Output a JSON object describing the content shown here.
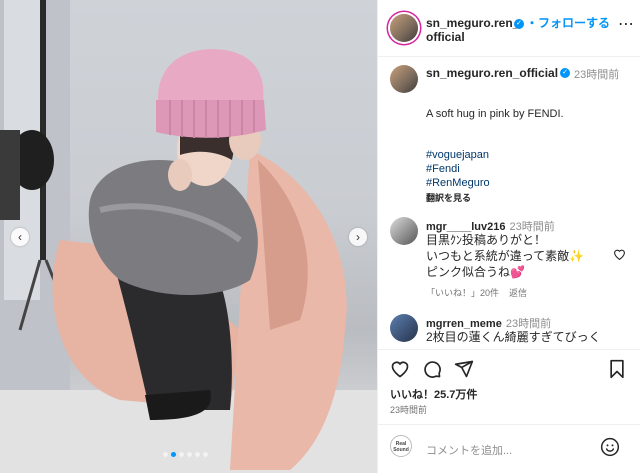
{
  "post": {
    "username": "sn_meguro.ren_official",
    "username_line1": "sn_meguro.ren_",
    "username_line2": "official",
    "follow_label": "・フォローする",
    "more_icon": "more-horizontal-icon",
    "carousel": {
      "total_slides": 6,
      "active_slide": 2
    }
  },
  "caption": {
    "username": "sn_meguro.ren_official",
    "time": "23時間前",
    "text": "A soft hug in pink by FENDI.",
    "hashtags": [
      "#voguejapan",
      "#Fendi",
      "#RenMeguro"
    ],
    "translate_label": "翻訳を見る"
  },
  "comments": [
    {
      "username": "mgr____luv216",
      "time": "23時間前",
      "lines": [
        "目黒ｸﾝ投稿ありがと！",
        "いつもと系統が違って素敵✨",
        "ピンク似合うね💕"
      ],
      "likes_label": "「いいね！」20件",
      "reply_label": "返信"
    },
    {
      "username": "mgrren_meme",
      "time": "23時間前",
      "lines": [
        "2枚目の蓮くん綺麗すぎてびっく"
      ]
    }
  ],
  "actions": {
    "likes": "いいね！25.7万件",
    "posted": "23時間前"
  },
  "add_comment": {
    "badge_text_1": "Real",
    "badge_text_2": "Sound",
    "placeholder": "コメントを追加..."
  },
  "colors": {
    "link_blue": "#0095f6",
    "hashtag": "#00376b",
    "secondary_text": "#737373",
    "hat_pink": "#e7a9c4",
    "coat_pink": "#e7b3a3"
  }
}
